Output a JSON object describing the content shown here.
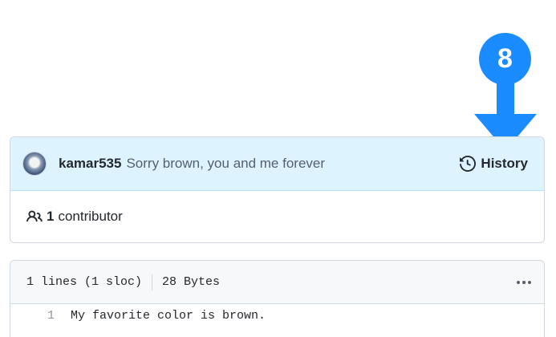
{
  "annotation": {
    "step_number": "8",
    "color": "#1a8cff"
  },
  "commit": {
    "author": "kamar535",
    "message": "Sorry brown, you and me forever",
    "history_label": "History"
  },
  "contributors": {
    "count": "1",
    "label": "contributor"
  },
  "file": {
    "lines_info": "1 lines (1 sloc)",
    "size": "28 Bytes",
    "lines": [
      {
        "number": "1",
        "code": "My favorite color is brown."
      }
    ]
  },
  "icons": {
    "avatar": "avatar",
    "history": "history-icon",
    "people": "people-icon",
    "more": "kebab-horizontal-icon"
  }
}
